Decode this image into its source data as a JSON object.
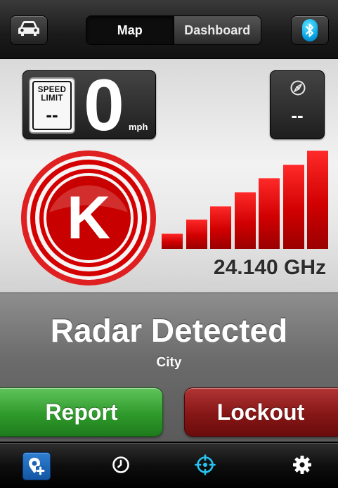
{
  "topbar": {
    "car_icon": "car-icon",
    "tabs": [
      {
        "label": "Map",
        "active": true
      },
      {
        "label": "Dashboard",
        "active": false
      }
    ],
    "bluetooth_icon": "bluetooth-icon",
    "bluetooth_color": "#0aa7e8"
  },
  "speed": {
    "limit_label_line1": "SPEED",
    "limit_label_line2": "LIMIT",
    "limit_value": "--",
    "current": "0",
    "unit": "mph"
  },
  "heading": {
    "icon": "compass-icon",
    "value": "--"
  },
  "alert": {
    "band_letter": "K",
    "band_color": "#d40000",
    "signal_strength": 7,
    "signal_max": 7,
    "frequency": "24.140 GHz",
    "title": "Radar Detected",
    "mode": "City"
  },
  "actions": {
    "report_label": "Report",
    "report_color": "#2f9a2c",
    "lockout_label": "Lockout",
    "lockout_color": "#861616"
  },
  "tabbar": {
    "items": [
      {
        "icon": "add-location-icon",
        "selected": true
      },
      {
        "icon": "history-clock-icon",
        "selected": false
      },
      {
        "icon": "radar-target-icon",
        "selected": false
      },
      {
        "icon": "settings-gear-icon",
        "selected": false
      }
    ],
    "accent_color": "#27c3f0"
  }
}
